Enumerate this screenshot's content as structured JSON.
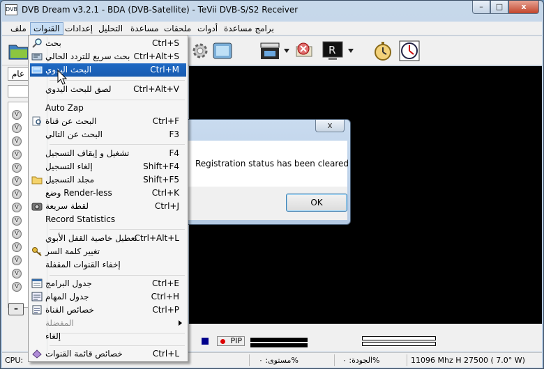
{
  "window": {
    "title": "DVB Dream v3.2.1 - BDA (DVB-Satellite)  -  TeVii DVB-S/S2 Receiver",
    "app_icon_text": "DVB",
    "buttons": {
      "minimize": "–",
      "maximize": "□",
      "close": "x"
    }
  },
  "menubar": {
    "items": [
      "ملف",
      "القنوات",
      "إعدادات",
      "التحليل",
      "مساعدة",
      "ملحقات",
      "أدوات",
      "برامج مساعدة"
    ],
    "open_item": "القنوات"
  },
  "left_panel": {
    "tab_label": "عام",
    "list_icon_letter": "V",
    "collapse_button": "–"
  },
  "dialog": {
    "close_label": "x",
    "message": "Registration status has been cleared",
    "ok_label": "OK"
  },
  "bottom": {
    "pip_label": "PIP"
  },
  "statusbar": {
    "cpu": "CPU:",
    "level": "مستوى: ٠%",
    "quality": "الجودة: ٠%",
    "frequency": "11096 Mhz  H  27500  ( 7.0° W)"
  },
  "channel_menu": {
    "items": [
      {
        "label": "بحث",
        "shortcut": "Ctrl+S",
        "icon": "search-icon"
      },
      {
        "label": "بحث سريع للتردد الحالي",
        "shortcut": "Ctrl+Alt+S",
        "icon": "fast-scan-icon"
      },
      {
        "label": "البحث اليدوي",
        "shortcut": "Ctrl+M",
        "icon": "manual-scan-icon",
        "highlighted": true
      },
      {
        "label": "لصق للبحث اليدوي",
        "shortcut": "Ctrl+Alt+V"
      },
      {
        "label": "Auto Zap",
        "shortcut": ""
      },
      {
        "label": "البحث عن قناة",
        "shortcut": "Ctrl+F",
        "icon": "find-channel-icon"
      },
      {
        "label": "البحث عن التالي",
        "shortcut": "F3"
      },
      {
        "label": "تشغيل و إيقاف التسجيل",
        "shortcut": "F4"
      },
      {
        "label": "إلغاء التسجيل",
        "shortcut": "Shift+F4"
      },
      {
        "label": "مجلد التسجيل",
        "shortcut": "Shift+F5",
        "icon": "folder-icon"
      },
      {
        "label": "وضع Render-less",
        "shortcut": "Ctrl+K"
      },
      {
        "label": "لقطة سريعة",
        "shortcut": "Ctrl+J",
        "icon": "camera-icon"
      },
      {
        "label": "Record Statistics",
        "shortcut": ""
      },
      {
        "label": "تعطيل خاصية القفل الأبوي",
        "shortcut": "Ctrl+Alt+L"
      },
      {
        "label": "تغيير كلمة السر",
        "shortcut": "",
        "icon": "key-icon"
      },
      {
        "label": "إخفاء القنوات المقفلة",
        "shortcut": ""
      },
      {
        "label": "جدول البرامج",
        "shortcut": "Ctrl+E",
        "icon": "epg-icon"
      },
      {
        "label": "جدول المهام",
        "shortcut": "Ctrl+H",
        "icon": "scheduler-icon"
      },
      {
        "label": "خصائص القناة",
        "shortcut": "Ctrl+P",
        "icon": "channel-properties-icon"
      },
      {
        "label": "المفضلة",
        "shortcut": "",
        "disabled": true,
        "submenu": true
      },
      {
        "label": "إلغاء",
        "shortcut": ""
      },
      {
        "label": "خصائص قائمة القنوات",
        "shortcut": "Ctrl+L",
        "icon": "list-properties-icon"
      }
    ]
  },
  "colors": {
    "highlight": "#1e69c4",
    "video_background": "#000000",
    "pip_dot": "#dd0000"
  }
}
